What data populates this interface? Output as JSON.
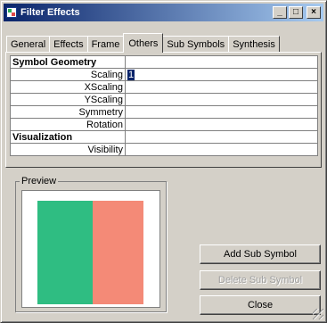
{
  "window": {
    "title": "Filter Effects",
    "controls": {
      "minimize": "_",
      "maximize": "□",
      "close": "×"
    }
  },
  "tabs": [
    {
      "label": "General",
      "active": false
    },
    {
      "label": "Effects",
      "active": false
    },
    {
      "label": "Frame",
      "active": false
    },
    {
      "label": "Others",
      "active": true
    },
    {
      "label": "Sub Symbols",
      "active": false
    },
    {
      "label": "Synthesis",
      "active": false
    }
  ],
  "properties": {
    "section1": "Symbol Geometry",
    "scaling": {
      "label": "Scaling",
      "value": "1"
    },
    "xscaling": {
      "label": "XScaling",
      "value": ""
    },
    "yscaling": {
      "label": "YScaling",
      "value": ""
    },
    "symmetry": {
      "label": "Symmetry",
      "value": ""
    },
    "rotation": {
      "label": "Rotation",
      "value": ""
    },
    "section2": "Visualization",
    "visibility": {
      "label": "Visibility",
      "value": ""
    }
  },
  "preview": {
    "label": "Preview",
    "swatches": [
      {
        "name": "green",
        "color": "#2fbd82"
      },
      {
        "name": "salmon",
        "color": "#f48a77"
      }
    ]
  },
  "buttons": {
    "add_sub_symbol": "Add Sub Symbol",
    "delete_sub_symbol": "Delete Sub Symbol",
    "close": "Close"
  }
}
